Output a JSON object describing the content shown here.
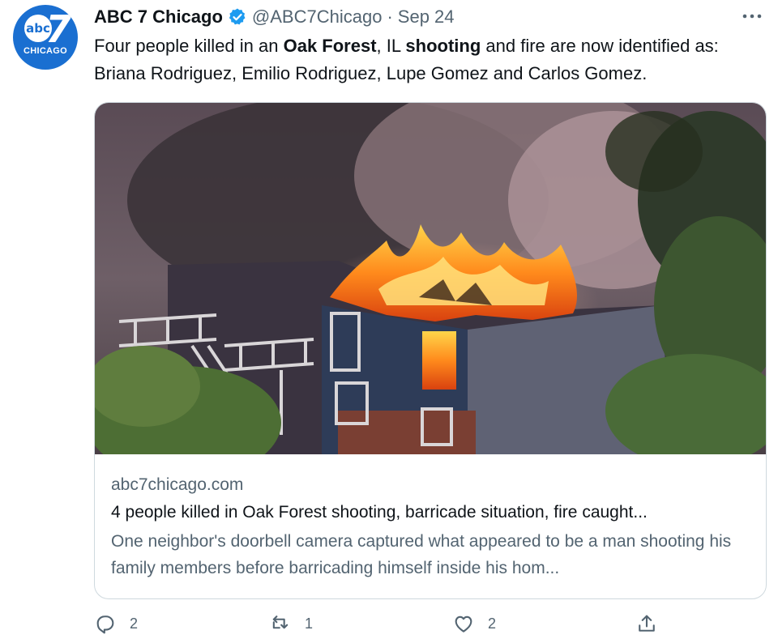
{
  "account": {
    "display_name": "ABC 7 Chicago",
    "handle": "@ABC7Chicago",
    "separator": "·",
    "date": "Sep 24",
    "avatar": {
      "logo_text": "abc",
      "logo_number": "7",
      "city": "CHICAGO"
    }
  },
  "tweet": {
    "segments": [
      "Four people killed in an ",
      "Oak Forest",
      ", IL ",
      "shooting",
      " and fire are now identified as: Briana Rodriguez, Emilio Rodriguez, Lupe Gomez and Carlos Gomez."
    ]
  },
  "card": {
    "domain": "abc7chicago.com",
    "title": "4 people killed in Oak Forest shooting, barricade situation, fire caught...",
    "description": "One neighbor's doorbell camera captured what appeared to be a man shooting his family members before barricading himself inside his hom..."
  },
  "actions": {
    "reply_count": "2",
    "retweet_count": "1",
    "like_count": "2"
  },
  "icons": {
    "verified": "verified-badge-icon",
    "more": "more-options-icon",
    "reply": "reply-icon",
    "retweet": "retweet-icon",
    "like": "like-icon",
    "share": "share-icon"
  },
  "colors": {
    "brand_blue": "#1a6fd1",
    "verified_blue": "#1d9bf0",
    "secondary_text": "#536471",
    "border": "#cfd9de"
  }
}
